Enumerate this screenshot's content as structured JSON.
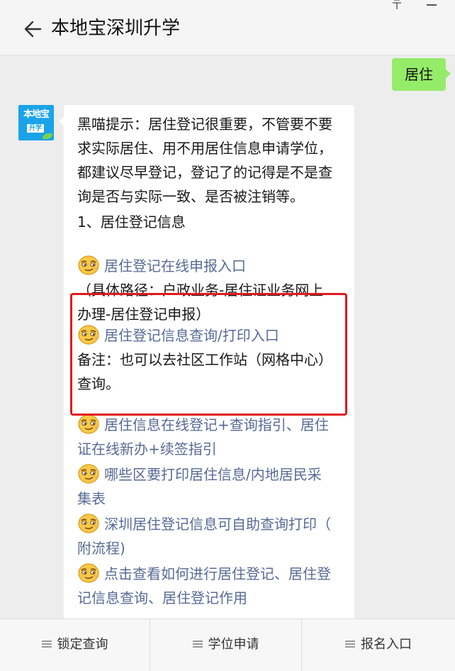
{
  "window": {
    "title": "本地宝深圳升学"
  },
  "chat": {
    "outgoing_message": "居住",
    "avatar": {
      "line1": "本地宝",
      "line2": "升学"
    },
    "incoming": {
      "intro_lines": [
        "黑喵提示：居住登记很重要，不管要不要",
        "求实际居住、用不用居住信息申请学位，",
        "都建议尽早登记，登记了的记得是不是查",
        "询是否与实际一致、是否被注销等。"
      ],
      "section_title": "1、居住登记信息",
      "link1": "居住登记在线申报入口",
      "path_lines": [
        "（具体路径：户政业务-居住证业务网上",
        "办理-居住登记申报）"
      ],
      "link2": "居住登记信息查询/打印入口",
      "note_lines": [
        "备注：也可以去社区工作站（网格中心）",
        "查询。"
      ],
      "link3_lines": [
        "居住信息在线登记+查询指引、居住",
        "证在线新办+续签指引"
      ],
      "link4_lines": [
        "哪些区要打印居住信息/内地居民采",
        "集表"
      ],
      "link5_lines": [
        "深圳居住登记信息可自助查询打印（",
        "附流程)"
      ],
      "link6_lines": [
        "点击查看如何进行居住登记、居住登",
        "记信息查询、居住登记作用"
      ]
    }
  },
  "bottom_menu": [
    {
      "label": "锁定查询"
    },
    {
      "label": "学位申请"
    },
    {
      "label": "报名入口"
    }
  ],
  "colors": {
    "link": "#576b95",
    "outgoing_bubble": "#95ec69",
    "highlight": "#e3191c",
    "avatar_bg": "#1aa3e8"
  },
  "icons": {
    "back": "arrow-left-icon",
    "pin": "pin-icon",
    "minimize": "minimize-icon",
    "emoji": "smirk-emoji-icon",
    "menu": "menu-lines-icon"
  }
}
